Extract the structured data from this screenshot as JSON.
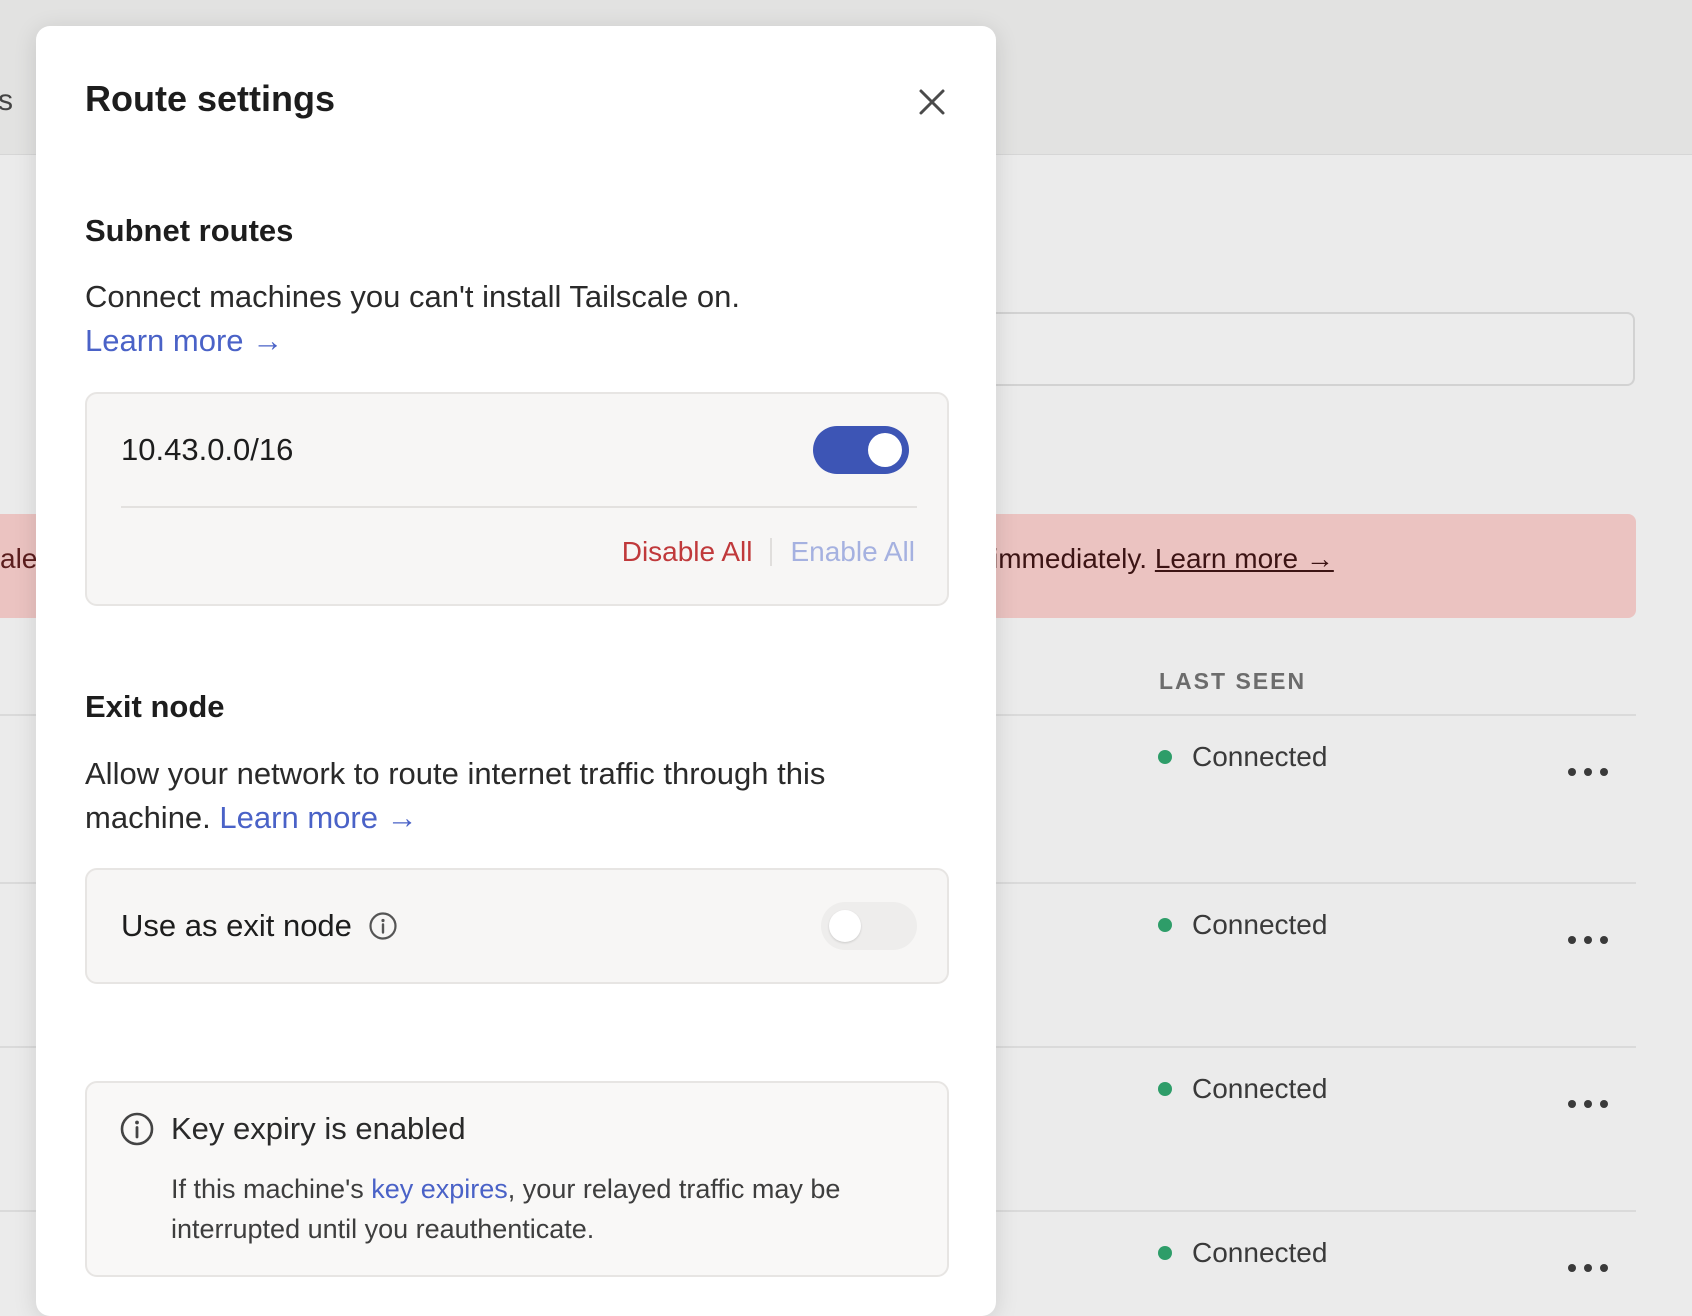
{
  "background": {
    "tab_fragment": "s",
    "banner": {
      "left_fragment": "ale",
      "text": "immediately. ",
      "link": "Learn more →"
    },
    "table": {
      "column_header": "LAST SEEN",
      "rows": [
        {
          "status": "Connected"
        },
        {
          "status": "Connected"
        },
        {
          "status": "Connected"
        },
        {
          "status": "Connected"
        }
      ]
    }
  },
  "modal": {
    "title": "Route settings",
    "close_icon": "close-icon",
    "subnet": {
      "title": "Subnet routes",
      "description": "Connect machines you can't install Tailscale on.",
      "learn_more": "Learn more →",
      "routes": [
        {
          "cidr": "10.43.0.0/16",
          "enabled": true
        }
      ],
      "disable_all": "Disable All",
      "enable_all": "Enable All"
    },
    "exit_node": {
      "title": "Exit node",
      "description": "Allow your network to route internet traffic through this machine.",
      "learn_more": "Learn more →",
      "toggle_label": "Use as exit node",
      "enabled": false
    },
    "notice": {
      "title": "Key expiry is enabled",
      "body_before": "If this machine's ",
      "body_link": "key expires",
      "body_after": ", your relayed traffic may be interrupted until you reauthenticate."
    }
  },
  "colors": {
    "accent": "#3d55b5",
    "link": "#4a62c7",
    "danger": "#c0393b",
    "status_connected": "#2e9d69",
    "banner_bg": "#ebc3c1"
  }
}
